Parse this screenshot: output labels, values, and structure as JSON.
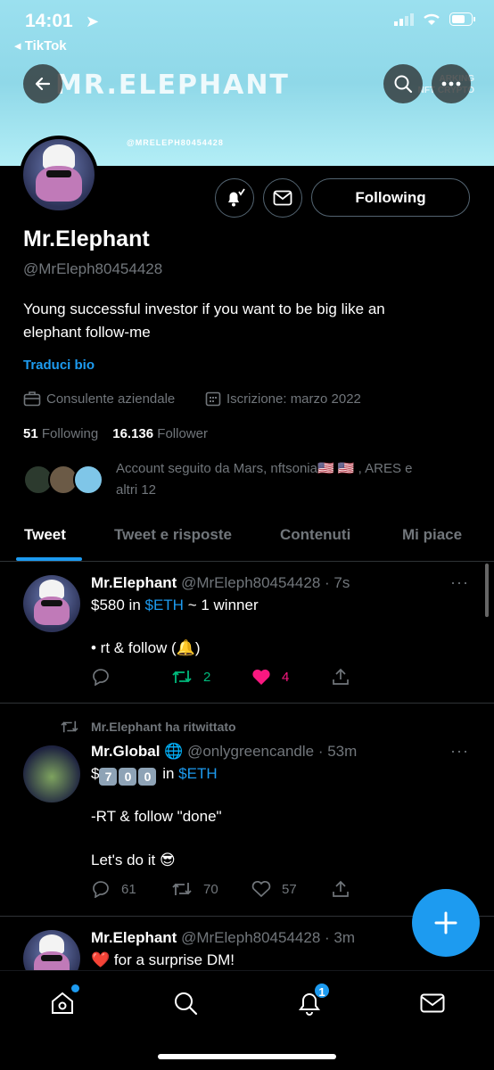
{
  "status_bar": {
    "time": "14:01",
    "back_app": "◂ TikTok"
  },
  "banner": {
    "title": "MR.ELEPHANT",
    "handle_text": "@MRELEPH80454428",
    "right_text_1": "ARKING",
    "right_text_2": "NFT CRYPTO"
  },
  "profile": {
    "name": "Mr.Elephant",
    "handle": "@MrEleph80454428",
    "bio_line1": "Young successful investor if you want to be big like an",
    "bio_line2": "elephant follow-me",
    "translate_label": "Traduci bio",
    "category": "Consulente aziendale",
    "joined": "Iscrizione: marzo 2022",
    "following_count": "51",
    "following_label": "Following",
    "followers_count": "16.136",
    "followers_label": "Follower",
    "followed_by_line1": "Account seguito da Mars, nftsonia🇺🇸 🇺🇸 , ARES e",
    "followed_by_line2": "altri 12",
    "follow_button": "Following"
  },
  "tabs": [
    "Tweet",
    "Tweet e risposte",
    "Contenuti",
    "Mi piace"
  ],
  "tweets": [
    {
      "name": "Mr.Elephant",
      "handle": "@MrEleph80454428 · 7s",
      "line1_a": "$580 in ",
      "line1_cash": "$ETH",
      "line1_b": " ~ 1 winner",
      "line2": "• rt & follow (🔔)",
      "replies": "",
      "retweets": "2",
      "likes": "4"
    },
    {
      "retweeted_label": "Mr.Elephant ha ritwittato",
      "name": "Mr.Global 🌐",
      "handle": "@onlygreencandle · 53m",
      "prefix": "$",
      "keys": [
        "7",
        "0",
        "0"
      ],
      "in_label": " in ",
      "cash": "$ETH",
      "line2": "-RT & follow \"done\"",
      "line3": "Let's do it 😎",
      "replies": "61",
      "retweets": "70",
      "likes": "57"
    },
    {
      "name": "Mr.Elephant",
      "handle": "@MrEleph80454428 · 3m",
      "line1": "❤️  for a surprise DM!"
    }
  ],
  "bottom_nav": {
    "notifications_badge": "1"
  },
  "colors": {
    "accent": "#1d9bf0",
    "retweet_green": "#00ba7c",
    "like_pink": "#f91880",
    "banner": "#9be0ef"
  },
  "icons": [
    "back-arrow-icon",
    "search-icon",
    "more-icon",
    "bell-subscribe-icon",
    "mail-icon",
    "briefcase-icon",
    "calendar-icon",
    "reply-icon",
    "retweet-icon",
    "heart-icon",
    "share-icon",
    "home-icon",
    "notifications-icon",
    "messages-icon",
    "plus-icon"
  ]
}
